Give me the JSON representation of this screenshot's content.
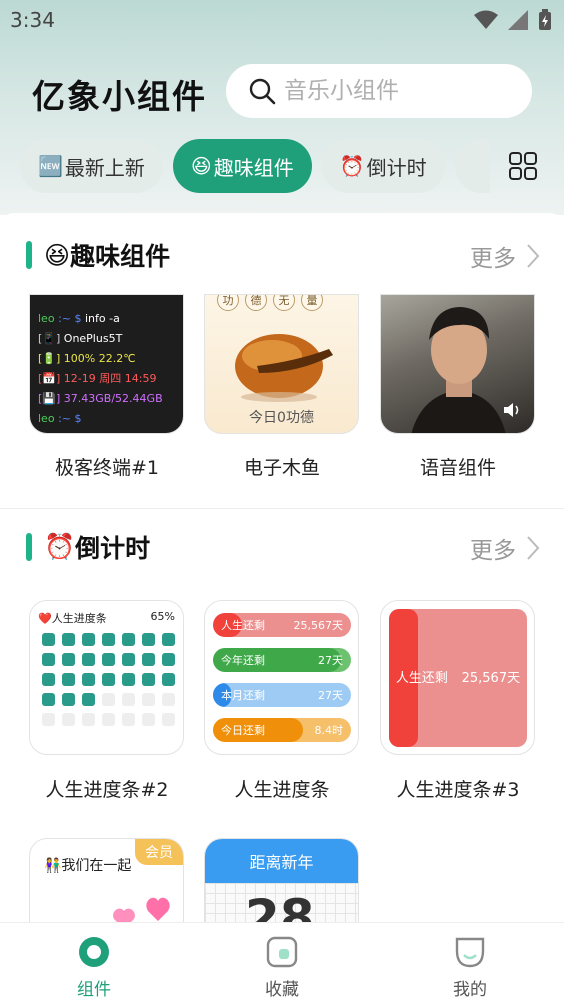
{
  "status_bar": {
    "time": "3:34"
  },
  "header": {
    "title": "亿象小组件",
    "search_placeholder": "音乐小组件"
  },
  "tabs": [
    {
      "emoji": "🆕",
      "label": "最新上新",
      "active": false
    },
    {
      "emoji": "😆",
      "label": "趣味组件",
      "active": true
    },
    {
      "emoji": "⏰",
      "label": "倒计时",
      "active": false
    },
    {
      "emoji": "",
      "label": "",
      "active": false
    }
  ],
  "colors": {
    "accent": "#1fa07a",
    "section_bar": "#1fb38a"
  },
  "section_fun": {
    "emoji": "😆",
    "title": "趣味组件",
    "more": "更多",
    "cards": [
      {
        "label": "极客终端#1"
      },
      {
        "label": "电子木鱼",
        "words": [
          "功",
          "德",
          "无",
          "量"
        ],
        "footer": "今日0功德"
      },
      {
        "label": "语音组件"
      }
    ],
    "terminal": {
      "prompt_user": "leo",
      "prompt_sep": ":~ $",
      "command": "info -a",
      "device": "OnePlus5T",
      "battery": "100% 22.2℃",
      "datetime": "12-19 周四 14:59",
      "storage": "37.43GB/52.44GB"
    }
  },
  "section_countdown": {
    "emoji": "⏰",
    "title": "倒计时",
    "more": "更多",
    "cards": [
      {
        "label": "人生进度条#2",
        "header": "❤️人生进度条",
        "percent": "65%",
        "filled_dots": 24,
        "total_dots": 35
      },
      {
        "label": "人生进度条"
      },
      {
        "label": "人生进度条#3",
        "text_left": "人生还剩",
        "text_right": "25,567天",
        "fill_fraction": 0.21
      },
      {
        "label": "",
        "title": "👫我们在一起",
        "badge": "会员"
      },
      {
        "label": "",
        "title": "距离新年",
        "number": "28"
      }
    ],
    "bars": [
      {
        "name": "人生还剩",
        "value": "25,567天",
        "fraction": 0.21,
        "fill": "#f0413a",
        "bg": "#ec8f8f"
      },
      {
        "name": "今年还剩",
        "value": "27天",
        "fraction": 0.93,
        "fill": "#3fa94a",
        "bg": "#6cc26e"
      },
      {
        "name": "本月还剩",
        "value": "27天",
        "fraction": 0.13,
        "fill": "#2d8ae8",
        "bg": "#9ecbf4"
      },
      {
        "name": "今日还剩",
        "value": "8.4时",
        "fraction": 0.65,
        "fill": "#f0900a",
        "bg": "#f6bf6a"
      }
    ]
  },
  "bottom_nav": [
    {
      "label": "组件",
      "icon": "widget-icon",
      "active": true
    },
    {
      "label": "收藏",
      "icon": "favorite-icon",
      "active": false
    },
    {
      "label": "我的",
      "icon": "profile-icon",
      "active": false
    }
  ]
}
